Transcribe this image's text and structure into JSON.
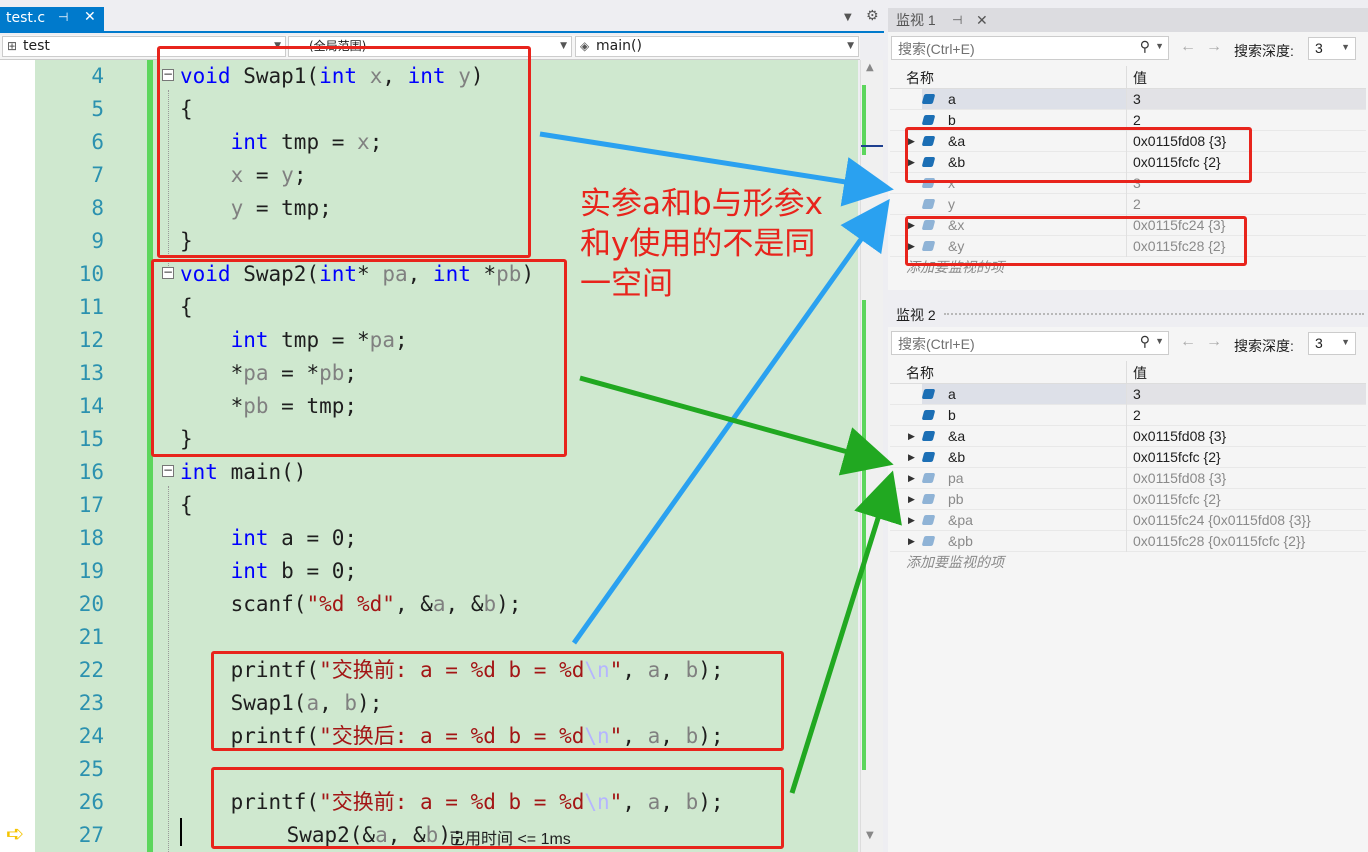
{
  "editor": {
    "tab_title": "test.c",
    "tab_pin": "⌂",
    "tab_close": "✕",
    "nav_project": "test",
    "nav_scope": "(全局范围)",
    "nav_function": "main()",
    "elapsed_text": "已用时间 <= 1ms",
    "lines": [
      {
        "n": "4"
      },
      {
        "n": "5"
      },
      {
        "n": "6"
      },
      {
        "n": "7"
      },
      {
        "n": "8"
      },
      {
        "n": "9"
      },
      {
        "n": "10"
      },
      {
        "n": "11"
      },
      {
        "n": "12"
      },
      {
        "n": "13"
      },
      {
        "n": "14"
      },
      {
        "n": "15"
      },
      {
        "n": "16"
      },
      {
        "n": "17"
      },
      {
        "n": "18"
      },
      {
        "n": "19"
      },
      {
        "n": "20"
      },
      {
        "n": "21"
      },
      {
        "n": "22"
      },
      {
        "n": "23"
      },
      {
        "n": "24"
      },
      {
        "n": "25"
      },
      {
        "n": "26"
      },
      {
        "n": "27"
      }
    ]
  },
  "code_tokens": {
    "l4": [
      "void",
      " Swap1(",
      "int",
      " ",
      "x",
      ", ",
      "int",
      " ",
      "y",
      ")"
    ],
    "l5": "{",
    "l6": [
      "    ",
      "int",
      " tmp = ",
      "x",
      ";"
    ],
    "l7": [
      "    ",
      "x",
      " = ",
      "y",
      ";"
    ],
    "l8": [
      "    ",
      "y",
      " = tmp;"
    ],
    "l9": "}",
    "l10": [
      "void",
      " Swap2(",
      "int",
      "* ",
      "pa",
      ", ",
      "int",
      " *",
      "pb",
      ")"
    ],
    "l11": "{",
    "l12": [
      "    ",
      "int",
      " tmp = *",
      "pa",
      ";"
    ],
    "l13": [
      "    *",
      "pa",
      " = *",
      "pb",
      ";"
    ],
    "l14": [
      "    *",
      "pb",
      " = tmp;"
    ],
    "l15": "}",
    "l16": [
      "int",
      " main()"
    ],
    "l17": "{",
    "l18": [
      "    ",
      "int",
      " a = 0;"
    ],
    "l19": [
      "    ",
      "int",
      " b = 0;"
    ],
    "l20": [
      "    scanf(",
      "\"%d %d\"",
      ", &",
      "a",
      ", &",
      "b",
      ");"
    ],
    "l21": "",
    "l22": [
      "    printf(",
      "\"交换前: a = %d b = %d",
      "\\n",
      "\"",
      ", ",
      "a",
      ", ",
      "b",
      ");"
    ],
    "l23": [
      "    Swap1(",
      "a",
      ", ",
      "b",
      ");"
    ],
    "l24": [
      "    printf(",
      "\"交换后: a = %d b = %d",
      "\\n",
      "\"",
      ", ",
      "a",
      ", ",
      "b",
      ");"
    ],
    "l25": "",
    "l26": [
      "    printf(",
      "\"交换前: a = %d b = %d",
      "\\n",
      "\"",
      ", ",
      "a",
      ", ",
      "b",
      ");"
    ],
    "l27": [
      "    Swap2(&",
      "a",
      ", &",
      "b",
      ");"
    ]
  },
  "watch1": {
    "title": "监视 1",
    "search_placeholder": "搜索(Ctrl+E)",
    "depth_label": "搜索深度:",
    "depth_value": "3",
    "col_name": "名称",
    "col_value": "值",
    "rows": [
      {
        "name": "a",
        "value": "3",
        "expandable": false,
        "stale": false
      },
      {
        "name": "b",
        "value": "2",
        "expandable": false,
        "stale": false
      },
      {
        "name": "&a",
        "value": "0x0115fd08 {3}",
        "expandable": true,
        "stale": false
      },
      {
        "name": "&b",
        "value": "0x0115fcfc {2}",
        "expandable": true,
        "stale": false
      },
      {
        "name": "x",
        "value": "3",
        "expandable": false,
        "stale": true
      },
      {
        "name": "y",
        "value": "2",
        "expandable": false,
        "stale": true
      },
      {
        "name": "&x",
        "value": "0x0115fc24 {3}",
        "expandable": true,
        "stale": true
      },
      {
        "name": "&y",
        "value": "0x0115fc28 {2}",
        "expandable": true,
        "stale": true
      }
    ],
    "add_text": "添加要监视的项"
  },
  "watch2": {
    "title": "监视 2",
    "search_placeholder": "搜索(Ctrl+E)",
    "depth_label": "搜索深度:",
    "depth_value": "3",
    "col_name": "名称",
    "col_value": "值",
    "rows": [
      {
        "name": "a",
        "value": "3",
        "expandable": false,
        "stale": false
      },
      {
        "name": "b",
        "value": "2",
        "expandable": false,
        "stale": false
      },
      {
        "name": "&a",
        "value": "0x0115fd08 {3}",
        "expandable": true,
        "stale": false
      },
      {
        "name": "&b",
        "value": "0x0115fcfc {2}",
        "expandable": true,
        "stale": false
      },
      {
        "name": "pa",
        "value": "0x0115fd08 {3}",
        "expandable": true,
        "stale": true
      },
      {
        "name": "pb",
        "value": "0x0115fcfc {2}",
        "expandable": true,
        "stale": true
      },
      {
        "name": "&pa",
        "value": "0x0115fc24 {0x0115fd08 {3}}",
        "expandable": true,
        "stale": true
      },
      {
        "name": "&pb",
        "value": "0x0115fc28 {0x0115fcfc {2}}",
        "expandable": true,
        "stale": true
      }
    ],
    "add_text": "添加要监视的项"
  },
  "annotation": {
    "text": "实参a和b与形参x和y使用的不是同一空间",
    "color": "#e8241c"
  },
  "colors": {
    "accent": "#007acc",
    "changed_bg": "#cfe8cf",
    "keyword": "#0000ff",
    "string": "#a31515",
    "line_number": "#2b91af",
    "arrow_blue": "#2aa1f0",
    "arrow_green": "#21a821"
  }
}
